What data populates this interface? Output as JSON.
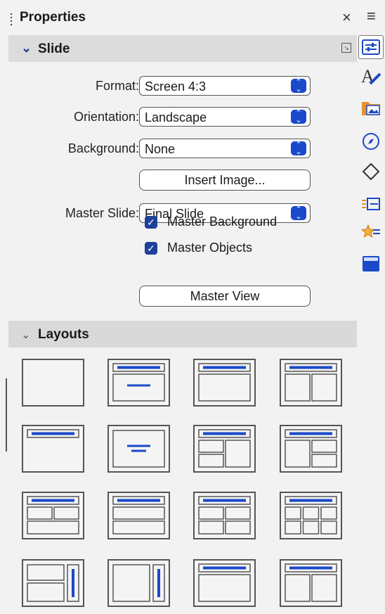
{
  "panel": {
    "title": "Properties",
    "close": "×",
    "menu": "≡"
  },
  "slide_section": {
    "title": "Slide",
    "format_label": "Format:",
    "format_value": "Screen 4:3",
    "orientation_label": "Orientation:",
    "orientation_value": "Landscape",
    "background_label": "Background:",
    "background_value": "None",
    "insert_image": "Insert Image...",
    "master_slide_label": "Master Slide:",
    "master_slide_value": "Final Slide",
    "master_background": "Master Background",
    "master_background_checked": true,
    "master_objects": "Master Objects",
    "master_objects_checked": true,
    "master_view": "Master View"
  },
  "layouts_section": {
    "title": "Layouts",
    "layouts": [
      "blank",
      "title-content",
      "title-only",
      "title-2-content",
      "title-top",
      "centered-text",
      "title-content-2",
      "title-2-content-2",
      "title-2-content-over",
      "title-content-over",
      "title-4-content",
      "title-6-content",
      "title-vertical",
      "vertical-title",
      "title-content-wide",
      "title-2-content-wide"
    ]
  },
  "deck": {
    "tabs": [
      "properties-icon",
      "styles-icon",
      "gallery-icon",
      "navigator-icon",
      "shapes-icon",
      "animation-icon",
      "transition-icon",
      "master-slides-icon"
    ],
    "active": "properties-icon"
  },
  "colors": {
    "accent": "#1a49c9",
    "section_bg": "#dcdcdc",
    "checkbox": "#1e3f9a"
  }
}
